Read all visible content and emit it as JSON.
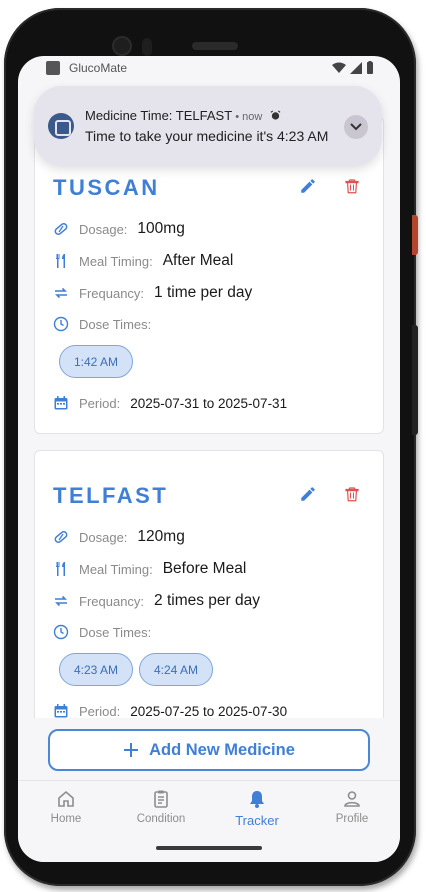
{
  "status_bar": {
    "app_name": "GlucoMate"
  },
  "notification": {
    "title": "Medicine Time: TELFAST",
    "meta": " • now",
    "body": "Time to take your medicine it's 4:23 AM"
  },
  "labels": {
    "dosage": "Dosage:",
    "meal_timing": "Meal Timing:",
    "frequency": "Frequancy:",
    "dose_times": "Dose Times:",
    "period": "Period:"
  },
  "medicines": [
    {
      "name": "TUSCAN",
      "dosage": "100mg",
      "meal_timing": "After Meal",
      "frequency": "1 time per day",
      "dose_times": [
        "1:42 AM"
      ],
      "period": "2025-07-31 to 2025-07-31"
    },
    {
      "name": "TELFAST",
      "dosage": "120mg",
      "meal_timing": "Before Meal",
      "frequency": "2 times per day",
      "dose_times": [
        "4:23 AM",
        "4:24 AM"
      ],
      "period": "2025-07-25 to 2025-07-30"
    }
  ],
  "add_button": {
    "label": "Add New Medicine"
  },
  "nav": {
    "items": [
      {
        "label": "Home",
        "icon": "home-icon"
      },
      {
        "label": "Condition",
        "icon": "clipboard-icon"
      },
      {
        "label": "Tracker",
        "icon": "bell-icon",
        "active": true
      },
      {
        "label": "Profile",
        "icon": "person-icon"
      }
    ]
  },
  "colors": {
    "accent": "#3f7fd6",
    "delete": "#e05252",
    "chip_bg": "#d3e2f7"
  }
}
